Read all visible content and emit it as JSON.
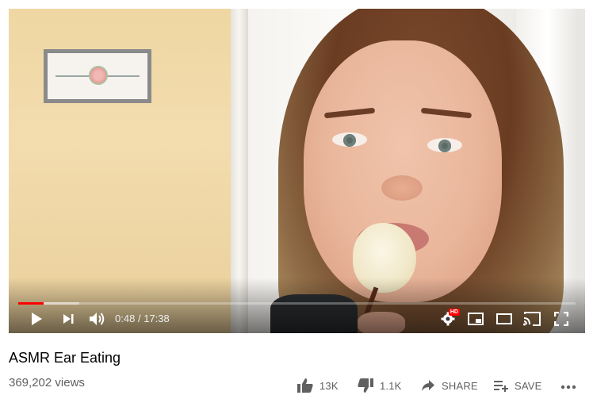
{
  "player": {
    "current_time": "0:48",
    "duration": "17:38",
    "time_separator": "/",
    "hd_badge": "HD",
    "played_fraction": 0.045,
    "buffered_fraction": 0.11,
    "progress_color": "#ff0000"
  },
  "video": {
    "title": "ASMR Ear Eating",
    "views": "369,202 views"
  },
  "actions": {
    "like_count": "13K",
    "dislike_count": "1.1K",
    "share_label": "SHARE",
    "save_label": "SAVE"
  },
  "icons": {
    "play": "play-icon",
    "next": "next-icon",
    "volume": "volume-icon",
    "settings": "settings-gear-icon",
    "miniplayer": "miniplayer-icon",
    "theater": "theater-mode-icon",
    "cast": "cast-icon",
    "fullscreen": "fullscreen-icon",
    "like": "thumbs-up-icon",
    "dislike": "thumbs-down-icon",
    "share": "share-arrow-icon",
    "save": "playlist-add-icon",
    "more": "more-horizontal-icon"
  }
}
